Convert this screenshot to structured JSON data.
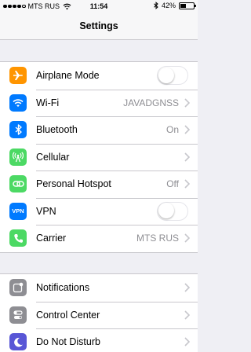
{
  "status_bar": {
    "carrier": "MTS RUS",
    "signal_bars_filled": 4,
    "signal_bars_total": 5,
    "wifi_icon": "wifi-icon",
    "time": "11:54",
    "bluetooth_icon": "bluetooth-icon",
    "battery_percent": "42%",
    "battery_level": 0.42
  },
  "nav": {
    "title": "Settings"
  },
  "colors": {
    "airplane": "#ff9500",
    "wifi": "#007aff",
    "bluetooth": "#007aff",
    "cellular": "#4cd964",
    "hotspot": "#4cd964",
    "vpn": "#007aff",
    "carrier": "#4cd964",
    "notifications": "#8e8e93",
    "control_center": "#8e8e93",
    "do_not_disturb": "#5856d6"
  },
  "group1": [
    {
      "label": "Airplane Mode",
      "icon": "airplane-icon",
      "control": "toggle",
      "on": false
    },
    {
      "label": "Wi-Fi",
      "icon": "wifi-icon",
      "value": "JAVADGNSS",
      "control": "chevron"
    },
    {
      "label": "Bluetooth",
      "icon": "bluetooth-icon",
      "value": "On",
      "control": "chevron"
    },
    {
      "label": "Cellular",
      "icon": "cellular-antenna-icon",
      "control": "chevron"
    },
    {
      "label": "Personal Hotspot",
      "icon": "hotspot-link-icon",
      "value": "Off",
      "control": "chevron"
    },
    {
      "label": "VPN",
      "icon": "vpn-icon",
      "icon_text": "VPN",
      "control": "toggle",
      "on": false
    },
    {
      "label": "Carrier",
      "icon": "phone-icon",
      "value": "MTS RUS",
      "control": "chevron"
    }
  ],
  "group2": [
    {
      "label": "Notifications",
      "icon": "notifications-icon",
      "control": "chevron"
    },
    {
      "label": "Control Center",
      "icon": "control-center-icon",
      "control": "chevron"
    },
    {
      "label": "Do Not Disturb",
      "icon": "moon-icon",
      "control": "chevron"
    }
  ]
}
